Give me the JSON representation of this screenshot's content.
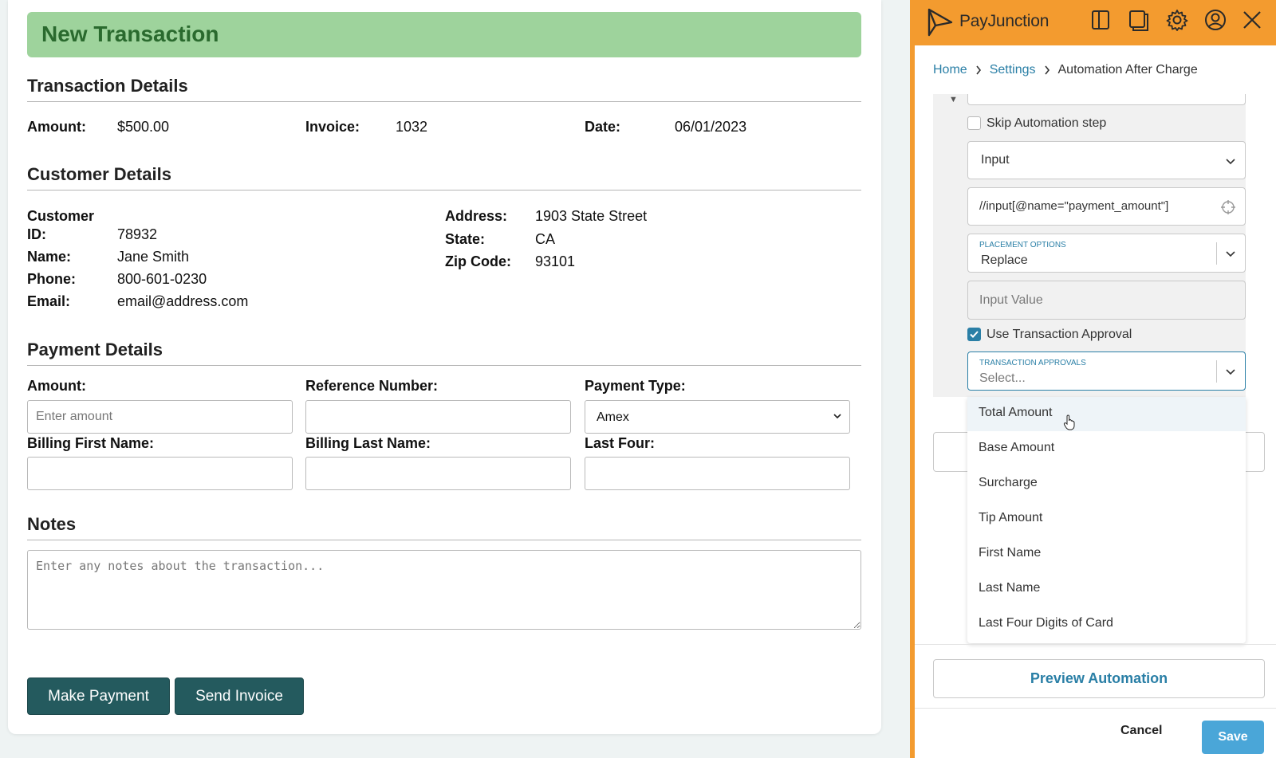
{
  "form": {
    "title": "New Transaction",
    "transaction_details": {
      "heading": "Transaction Details",
      "amount_label": "Amount:",
      "amount_value": "$500.00",
      "invoice_label": "Invoice:",
      "invoice_value": "1032",
      "date_label": "Date:",
      "date_value": "06/01/2023"
    },
    "customer_details": {
      "heading": "Customer Details",
      "customer_id_label_line1": "Customer",
      "customer_id_label_line2": "ID:",
      "customer_id_value": "78932",
      "name_label": "Name:",
      "name_value": "Jane Smith",
      "phone_label": "Phone:",
      "phone_value": "800-601-0230",
      "email_label": "Email:",
      "email_value": "email@address.com",
      "address_label": "Address:",
      "address_value": "1903 State Street",
      "state_label": "State:",
      "state_value": "CA",
      "zip_label": "Zip Code:",
      "zip_value": "93101"
    },
    "payment_details": {
      "heading": "Payment Details",
      "amount_label": "Amount:",
      "amount_placeholder": "Enter amount",
      "reference_label": "Reference Number:",
      "payment_type_label": "Payment Type:",
      "payment_type_value": "Amex",
      "billing_first_label": "Billing First Name:",
      "billing_last_label": "Billing Last Name:",
      "last_four_label": "Last Four:"
    },
    "notes": {
      "heading": "Notes",
      "placeholder": "Enter any notes about the transaction..."
    },
    "buttons": {
      "make_payment": "Make Payment",
      "send_invoice": "Send Invoice"
    }
  },
  "panel": {
    "brand": "PayJunction",
    "accent_color": "#f39b2f",
    "toolbar_icons": [
      "sidebar-panel-icon",
      "popout-icon",
      "gear-icon",
      "user-circle-icon",
      "close-icon"
    ],
    "breadcrumb": {
      "home": "Home",
      "settings": "Settings",
      "current": "Automation After Charge"
    },
    "skip_step_label": "Skip Automation step",
    "skip_step_checked": false,
    "action_select_value": "Input",
    "xpath_value": "//input[@name=\"payment_amount\"]",
    "placement_options_label": "PLACEMENT OPTIONS",
    "placement_options_value": "Replace",
    "input_value_placeholder": "Input Value",
    "use_approval_label": "Use Transaction Approval",
    "use_approval_checked": true,
    "approvals_label": "TRANSACTION APPROVALS",
    "approvals_placeholder": "Select...",
    "approval_options": [
      "Total Amount",
      "Base Amount",
      "Surcharge",
      "Tip Amount",
      "First Name",
      "Last Name",
      "Last Four Digits of Card"
    ],
    "highlighted_option": "Total Amount",
    "preview_button": "Preview Automation",
    "cancel_button": "Cancel",
    "save_button": "Save"
  }
}
